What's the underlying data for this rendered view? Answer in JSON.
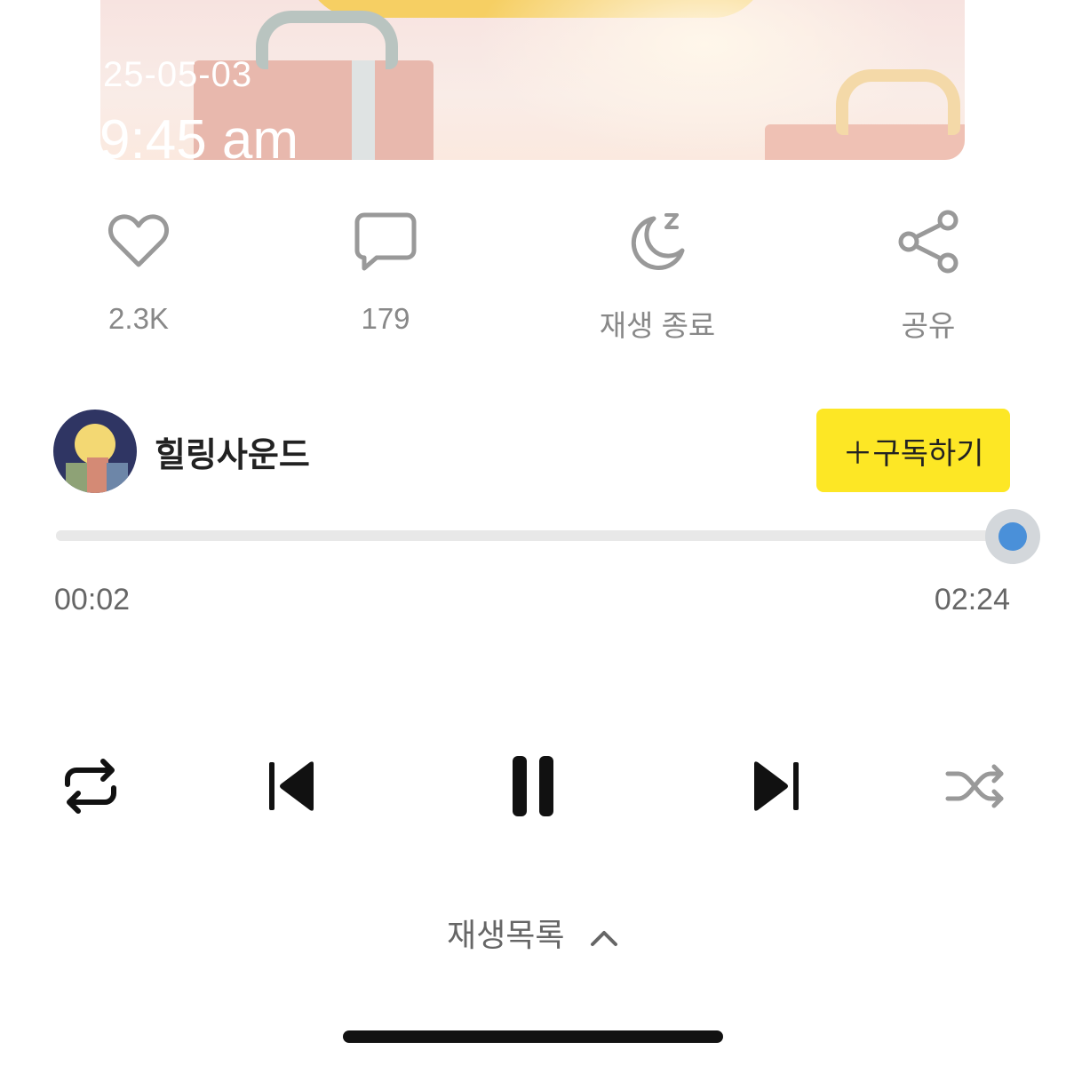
{
  "artwork": {
    "date": "25-05-03",
    "time": "9:45 am"
  },
  "actions": {
    "like": {
      "icon": "heart-icon",
      "label": "2.3K"
    },
    "comment": {
      "icon": "comment-icon",
      "label": "179"
    },
    "sleep_timer": {
      "icon": "moon-sleep-icon",
      "label": "재생 종료"
    },
    "share": {
      "icon": "share-icon",
      "label": "공유"
    }
  },
  "channel": {
    "name": "힐링사운드",
    "subscribe_label": "＋구독하기"
  },
  "player": {
    "current_time": "00:02",
    "total_time": "02:24",
    "progress_percent": 100,
    "accent": "#4a90d9"
  },
  "controls": {
    "repeat": "repeat-icon",
    "previous": "skip-previous-icon",
    "pause": "pause-icon",
    "next": "skip-next-icon",
    "shuffle": "shuffle-icon"
  },
  "playlist": {
    "label": "재생목록",
    "icon": "chevron-up-icon"
  },
  "colors": {
    "subscribe_bg": "#fde725",
    "thumb": "#4a90d9"
  }
}
